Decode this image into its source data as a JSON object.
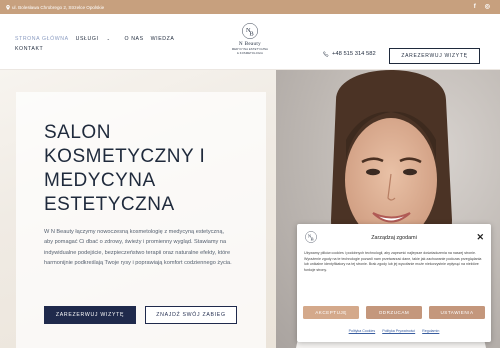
{
  "topbar": {
    "address": "ul. Bolesława Chrobrego 2, Strzelce Opolskie",
    "social": [
      {
        "icon": "facebook-icon",
        "glyph": "f"
      },
      {
        "icon": "instagram-icon",
        "glyph": "◎"
      }
    ],
    "color": "#c7a07e"
  },
  "nav": {
    "items": [
      {
        "label": "STRONA GŁÓWNA",
        "active": true
      },
      {
        "label": "USŁUGI",
        "dropdown": true
      },
      {
        "label": "O NAS"
      },
      {
        "label": "WIEDZA"
      },
      {
        "label": "KONTAKT"
      }
    ]
  },
  "logo": {
    "monogram": "NB",
    "name": "N Beauty",
    "sub_line1": "MEDYCYNA ESTETYCZNA",
    "sub_line2": "& KOSMETOLOGIA"
  },
  "header": {
    "phone": "+48 515 314 582",
    "reserve_label": "ZAREZERWUJ WIZYTĘ"
  },
  "hero": {
    "title": "SALON KOSMETYCZNY I MEDYCYNA ESTETYCZNA",
    "description": "W N Beauty łączymy nowoczesną kosmetologię z medycyną estetyczną, aby pomagać Ci dbać o zdrowy, świeży i promienny wygląd. Stawiamy na indywidualne podejście, bezpieczeństwo terapii oraz naturalne efekty, które harmonijnie podkreślają Twoje rysy i poprawiają komfort codziennego życia.",
    "primary_button": "ZAREZERWUJ WIZYTĘ",
    "secondary_button": "ZNAJDŹ SWÓJ ZABIEG"
  },
  "cookie": {
    "title": "Zarządzaj zgodami",
    "text": "Używamy plików cookies i podobnych technologii, aby zapewnić najlepsze doświadczenia na naszej stronie. Wyrażenie zgody na te technologie pozwoli nam przetwarzać dane, takie jak zachowanie podczas przeglądania lub unikalne identyfikatory na tej stronie. Brak zgody lub jej wycofanie może niekorzystnie wpłynąć na niektóre funkcje strony.",
    "accept": "AKCEPTUJĘ",
    "reject": "ODRZUCAM",
    "settings": "USTAWIENIA",
    "links": [
      "Polityka Cookies",
      "Polityka Prywatności",
      "Regulamin"
    ],
    "accent": "#d4a98b"
  }
}
